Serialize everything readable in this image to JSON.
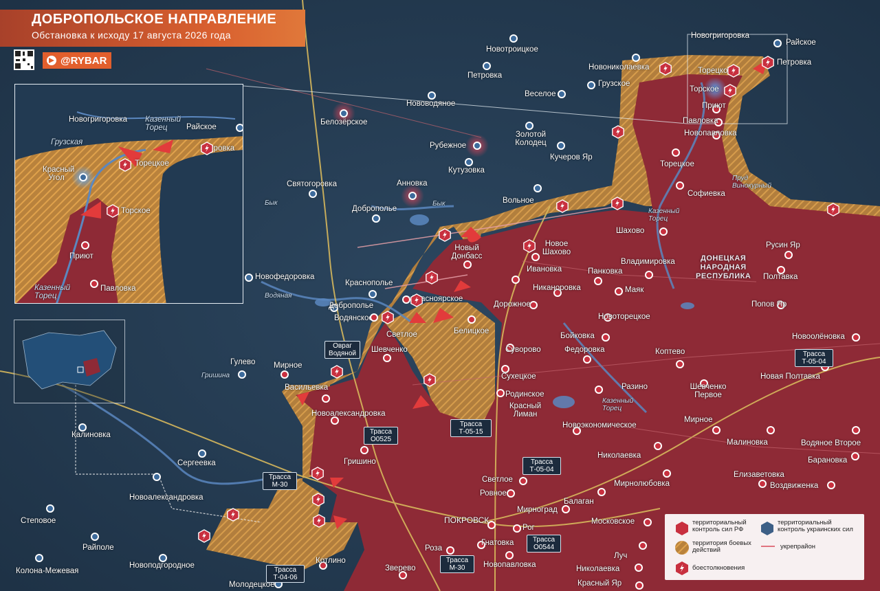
{
  "header": {
    "title": "ДОБРОПОЛЬСКОЕ НАПРАВЛЕНИЕ",
    "subtitle": "Обстановка к исходу 17 августа 2026 года"
  },
  "brand": {
    "name": "@RYBAR"
  },
  "colors": {
    "russian_control": "#9c2f3a",
    "combat_zone": "#c98a3a",
    "ukrainian_control": "#2e4a63",
    "header_accent": "#d9602f"
  },
  "region_label": "ДОНЕЦКАЯ\nНАРОДНАЯ\nРЕСПУБЛИКА",
  "settlements": [
    {
      "name": "Новогригоровка",
      "side": "ua"
    },
    {
      "name": "Райское",
      "side": "ua"
    },
    {
      "name": "Новотроицкое",
      "side": "ua"
    },
    {
      "name": "Петровка",
      "side": "ua"
    },
    {
      "name": "Новониколаевка",
      "side": "ua"
    },
    {
      "name": "Грузское",
      "side": "ua"
    },
    {
      "name": "Веселое",
      "side": "ua"
    },
    {
      "name": "Нововодяное",
      "side": "ua"
    },
    {
      "name": "Белозёрское",
      "side": "ua"
    },
    {
      "name": "Рубежное",
      "side": "ua"
    },
    {
      "name": "Золотой Колодец",
      "side": "ua"
    },
    {
      "name": "Кутузовка",
      "side": "ua"
    },
    {
      "name": "Кучеров Яр",
      "side": "ua"
    },
    {
      "name": "Святогоровка",
      "side": "ua"
    },
    {
      "name": "Анновка",
      "side": "ua"
    },
    {
      "name": "Вольное",
      "side": "ua"
    },
    {
      "name": "Доброполье",
      "side": "ua"
    },
    {
      "name": "Торецкое",
      "side": "ua"
    },
    {
      "name": "Торское",
      "side": "ru"
    },
    {
      "name": "Приют",
      "side": "ru"
    },
    {
      "name": "Павловка",
      "side": "ru"
    },
    {
      "name": "Новопавловка",
      "side": "ru"
    },
    {
      "name": "Софиевка",
      "side": "ru"
    },
    {
      "name": "Шахово",
      "side": "ru"
    },
    {
      "name": "Русин Яр",
      "side": "ru"
    },
    {
      "name": "Новое Шахово",
      "side": "ru"
    },
    {
      "name": "Новый Донбасс",
      "side": "ru"
    },
    {
      "name": "Владимировка",
      "side": "ru"
    },
    {
      "name": "Ивановка",
      "side": "ru"
    },
    {
      "name": "Панковка",
      "side": "ru"
    },
    {
      "name": "Полтавка",
      "side": "ru"
    },
    {
      "name": "Никаноровка",
      "side": "ru"
    },
    {
      "name": "Маяк",
      "side": "ru"
    },
    {
      "name": "Попов Яр",
      "side": "ru"
    },
    {
      "name": "Новофедоровка",
      "side": "ua"
    },
    {
      "name": "Краснополье",
      "side": "ua"
    },
    {
      "name": "Красноярское",
      "side": "ru"
    },
    {
      "name": "Дорожное",
      "side": "ru"
    },
    {
      "name": "Новоторецкое",
      "side": "ru"
    },
    {
      "name": "Водянское",
      "side": "ru"
    },
    {
      "name": "Светлое",
      "side": "ru"
    },
    {
      "name": "Белицкое",
      "side": "ru"
    },
    {
      "name": "Бойковка",
      "side": "ru"
    },
    {
      "name": "Новоолёновка",
      "side": "ru"
    },
    {
      "name": "Шевченко",
      "side": "ru"
    },
    {
      "name": "Суворово",
      "side": "ru"
    },
    {
      "name": "Федоровка",
      "side": "ru"
    },
    {
      "name": "Коптево",
      "side": "ru"
    },
    {
      "name": "Гулево",
      "side": "ua"
    },
    {
      "name": "Мирное",
      "side": "ru"
    },
    {
      "name": "Сухецкое",
      "side": "ru"
    },
    {
      "name": "Новая Полтавка",
      "side": "ru"
    },
    {
      "name": "Разино",
      "side": "ru"
    },
    {
      "name": "Васильевка",
      "side": "ru"
    },
    {
      "name": "Родинское",
      "side": "ru"
    },
    {
      "name": "Шевченко Первое",
      "side": "ru"
    },
    {
      "name": "Красный Лиман",
      "side": "ru"
    },
    {
      "name": "Новоалександровка",
      "side": "ru"
    },
    {
      "name": "Мирное",
      "side": "ru"
    },
    {
      "name": "Калиновка",
      "side": "ua"
    },
    {
      "name": "Новоэкономическое",
      "side": "ru"
    },
    {
      "name": "Малиновка",
      "side": "ru"
    },
    {
      "name": "Водяное Второе",
      "side": "ru"
    },
    {
      "name": "Николаевка",
      "side": "ru"
    },
    {
      "name": "Барановка",
      "side": "ru"
    },
    {
      "name": "Сергеевка",
      "side": "ua"
    },
    {
      "name": "Гришино",
      "side": "ru"
    },
    {
      "name": "Елизаветовка",
      "side": "ru"
    },
    {
      "name": "Светлое",
      "side": "ru"
    },
    {
      "name": "Мирнолюбовка",
      "side": "ru"
    },
    {
      "name": "Воздвиженка",
      "side": "ru"
    },
    {
      "name": "Новоалександровка",
      "side": "ua"
    },
    {
      "name": "Ровное",
      "side": "ru"
    },
    {
      "name": "Балаган",
      "side": "ru"
    },
    {
      "name": "Мирноград",
      "side": "ru"
    },
    {
      "name": "Степовое",
      "side": "ua"
    },
    {
      "name": "ПОКРОВСК",
      "side": "ru"
    },
    {
      "name": "Московское",
      "side": "ru"
    },
    {
      "name": "Рог",
      "side": "ru"
    },
    {
      "name": "Райполе",
      "side": "ua"
    },
    {
      "name": "Гнатовка",
      "side": "ru"
    },
    {
      "name": "Роза",
      "side": "ru"
    },
    {
      "name": "Луч",
      "side": "ru"
    },
    {
      "name": "Колона-Межевая",
      "side": "ua"
    },
    {
      "name": "Новоподгородное",
      "side": "ua"
    },
    {
      "name": "Котлино",
      "side": "ru"
    },
    {
      "name": "Новопавловка",
      "side": "ru"
    },
    {
      "name": "Зверево",
      "side": "ru"
    },
    {
      "name": "Николаевка",
      "side": "ru"
    },
    {
      "name": "Молодецкое",
      "side": "ua"
    },
    {
      "name": "Красный Яр",
      "side": "ru"
    }
  ],
  "rivers": [
    "Грузская",
    "Казенный Торец",
    "Бык",
    "Бык",
    "Казенный Торец",
    "Пруд Винокурный",
    "Водяная",
    "Гришина",
    "Казенный Торец",
    "Казенный Торец"
  ],
  "ravine_label": "Овраг Водяной",
  "roads": [
    {
      "label": "Трасса O0525"
    },
    {
      "label": "Трасса Т-05-15"
    },
    {
      "label": "Трасса Т-05-04"
    },
    {
      "label": "Трасса М-30"
    },
    {
      "label": "Трасса Т-05-04"
    },
    {
      "label": "Трасса O0544"
    },
    {
      "label": "Трасса М-30"
    },
    {
      "label": "Трасса Т-04-06"
    }
  ],
  "inset": {
    "settlements": [
      "Новогригоровка",
      "Казенный Торец",
      "Райское",
      "Грузская",
      "Петровка",
      "Красный Угол",
      "Торецкое",
      "Торское",
      "Приют",
      "Павловка",
      "Казенный Торец"
    ]
  },
  "legend": {
    "ru_control": "территориальный контроль сил РФ",
    "ua_control": "территориальный контроль украинских сил",
    "combat_zone": "территория боевых действий",
    "fortification": "укрепрайон",
    "clashes": "боестолкновения"
  }
}
